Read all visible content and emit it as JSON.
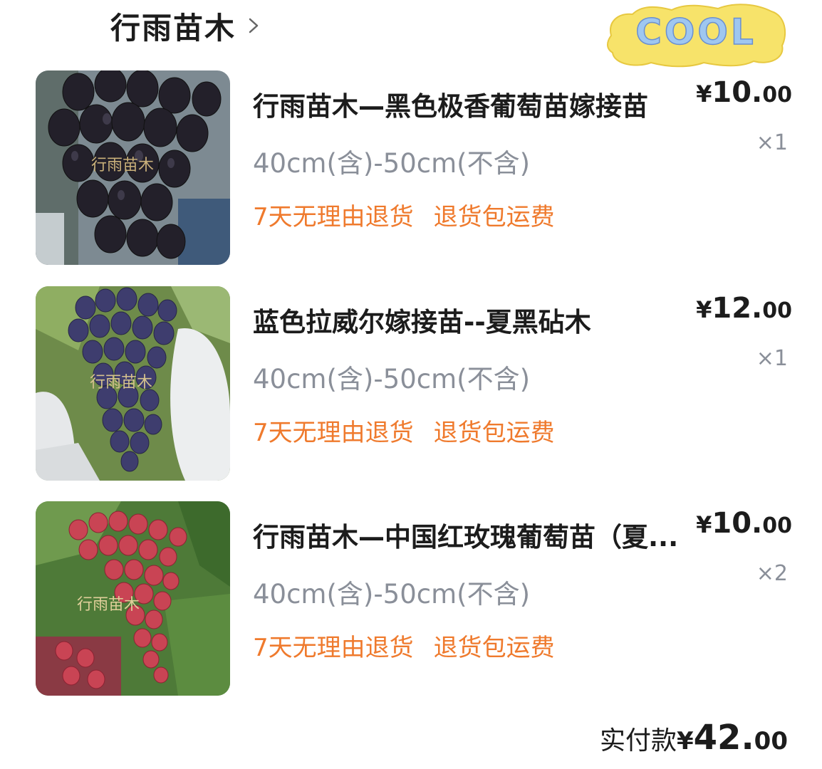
{
  "shop": {
    "name": "行雨苗木",
    "chevron_icon": "chevron-right-icon"
  },
  "badge": {
    "text": "COOL"
  },
  "items": [
    {
      "title": "行雨苗木—黑色极香葡萄苗嫁接苗",
      "spec": "40cm(含)-50cm(不含)",
      "tags": [
        "7天无理由退货",
        "退货包运费"
      ],
      "price": {
        "currency": "¥",
        "integer": "10.",
        "decimal": "00"
      },
      "qty": "×1",
      "watermark": "行雨苗木",
      "image": "black-grapes-photo"
    },
    {
      "title": "蓝色拉威尔嫁接苗--夏黑砧木",
      "spec": "40cm(含)-50cm(不含)",
      "tags": [
        "7天无理由退货",
        "退货包运费"
      ],
      "price": {
        "currency": "¥",
        "integer": "12.",
        "decimal": "00"
      },
      "qty": "×1",
      "watermark": "行雨苗木",
      "image": "blue-grapes-photo"
    },
    {
      "title": "行雨苗木—中国红玫瑰葡萄苗（夏...",
      "spec": "40cm(含)-50cm(不含)",
      "tags": [
        "7天无理由退货",
        "退货包运费"
      ],
      "price": {
        "currency": "¥",
        "integer": "10.",
        "decimal": "00"
      },
      "qty": "×2",
      "watermark": "行雨苗木",
      "image": "red-grapes-photo"
    }
  ],
  "total": {
    "label": "实付款",
    "currency": "¥",
    "integer": "42.",
    "decimal": "00"
  },
  "colors": {
    "tag": "#ef7a2d",
    "muted": "#8a8f99",
    "text": "#1c1c1c"
  }
}
